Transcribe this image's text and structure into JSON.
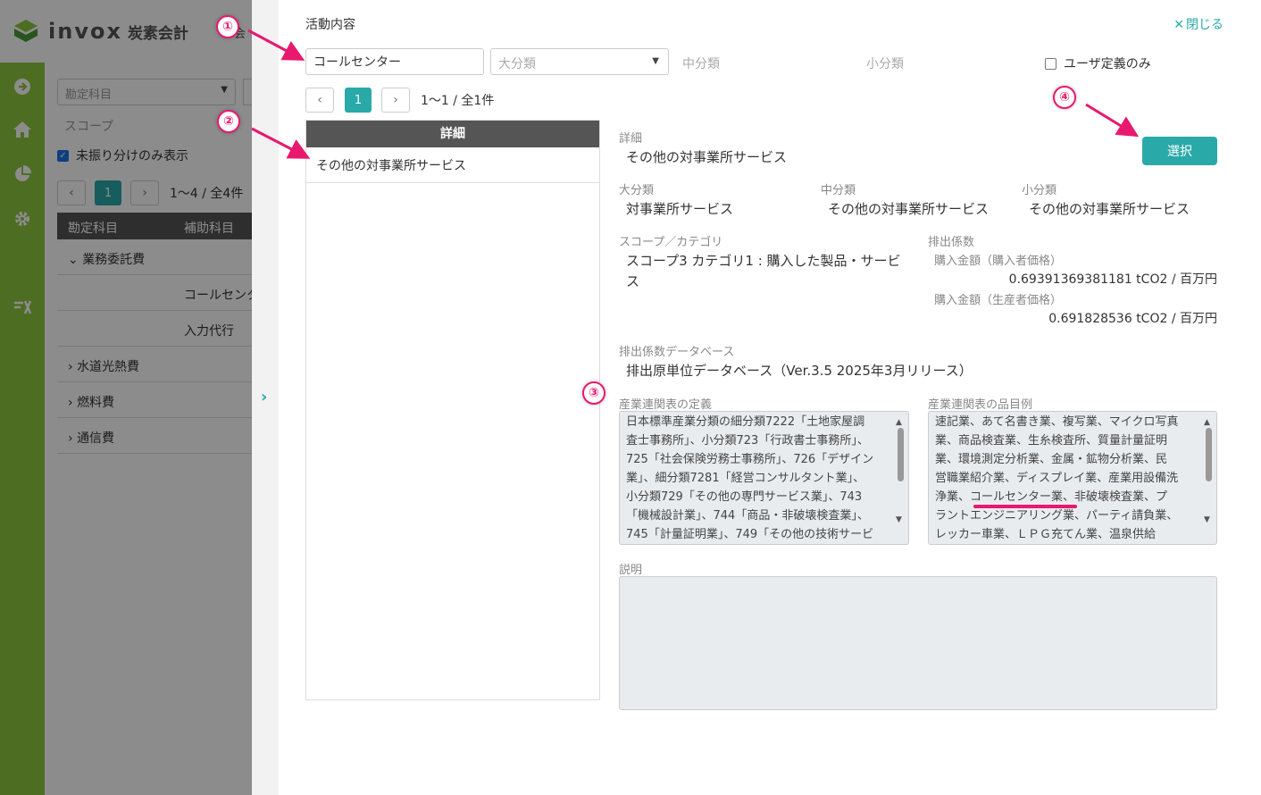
{
  "bg": {
    "logo": {
      "brand": "invox",
      "sub": "炭素会計"
    },
    "top_clip": "会",
    "account_select": "勘定科目",
    "scope_label": "スコープ",
    "unassigned_only": "未振り分けのみ表示",
    "pager": {
      "page": "1",
      "info": "1〜4 / 全4件"
    },
    "table_headers": [
      "勘定科目",
      "補助科目"
    ],
    "tree": [
      {
        "label": "業務委託費",
        "indent": false,
        "expanded": true
      },
      {
        "label": "コールセンタ",
        "indent": true
      },
      {
        "label": "入力代行",
        "indent": true
      },
      {
        "label": "水道光熱費",
        "indent": false,
        "expanded": false
      },
      {
        "label": "燃料費",
        "indent": false,
        "expanded": false
      },
      {
        "label": "通信費",
        "indent": false,
        "expanded": false
      }
    ]
  },
  "panel": {
    "title": "活動内容",
    "close_label": "閉じる",
    "search": {
      "value": "コールセンター"
    },
    "filters": {
      "large": "大分類",
      "middle": "中分類",
      "small": "小分類"
    },
    "user_defined_only": "ユーザ定義のみ",
    "pager": {
      "page": "1",
      "info": "1〜1 / 全1件"
    },
    "list": {
      "header": "詳細",
      "items": [
        "その他の対事業所サービス"
      ]
    },
    "detail": {
      "detail_label": "詳細",
      "detail_value": "その他の対事業所サービス",
      "select_button": "選択",
      "large_label": "大分類",
      "large_value": "対事業所サービス",
      "middle_label": "中分類",
      "middle_value": "その他の対事業所サービス",
      "small_label": "小分類",
      "small_value": "その他の対事業所サービス",
      "scope_label": "スコープ／カテゴリ",
      "scope_value_1": "スコープ3 カテゴリ1 : 購入した製品・サービ",
      "scope_value_2": "ス",
      "factor_label": "排出係数",
      "factor_buyer_label": "購入金額（購入者価格）",
      "factor_buyer_value": "0.69391369381181 tCO2 / 百万円",
      "factor_producer_label": "購入金額（生産者価格）",
      "factor_producer_value": "0.691828536 tCO2 / 百万円",
      "db_label": "排出係数データベース",
      "db_value": "排出原単位データベース（Ver.3.5 2025年3月リリース）",
      "io_def_label": "産業連関表の定義",
      "io_def_lines": [
        "日本標準産業分類の細分類7222「土地家屋調",
        "査士事務所」、小分類723「行政書士事務所」、",
        "725「社会保険労務士事務所」、726「デザイン",
        "業」、細分類7281「経営コンサルタント業」、",
        "小分類729「その他の専門サービス業」、743",
        "「機械設計業」、744「商品・非破壊検査業」、",
        "745「計量証明業」、749「その他の技術サービ"
      ],
      "io_items_label": "産業連関表の品目例",
      "io_items_lines": [
        "速記業、あて名書き業、複写業、マイクロ写真",
        "業、商品検査業、生糸検査所、質量計量証明",
        "業、環境測定分析業、金属・鉱物分析業、民",
        "営職業紹介業、ディスプレイ業、産業用設備洗",
        "浄業、コールセンター業、非破壊検査業、プ",
        "ラントエンジニアリング業、パーティ請負業、",
        "レッカー車業、ＬＰＧ充てん業、温泉供給"
      ],
      "desc_label": "説明",
      "desc_value": ""
    }
  },
  "annotations": [
    "①",
    "②",
    "③",
    "④"
  ],
  "colors": {
    "accent": "#2aa9a9",
    "sidebar": "#8dc63f",
    "annotation": "#e8196f"
  }
}
